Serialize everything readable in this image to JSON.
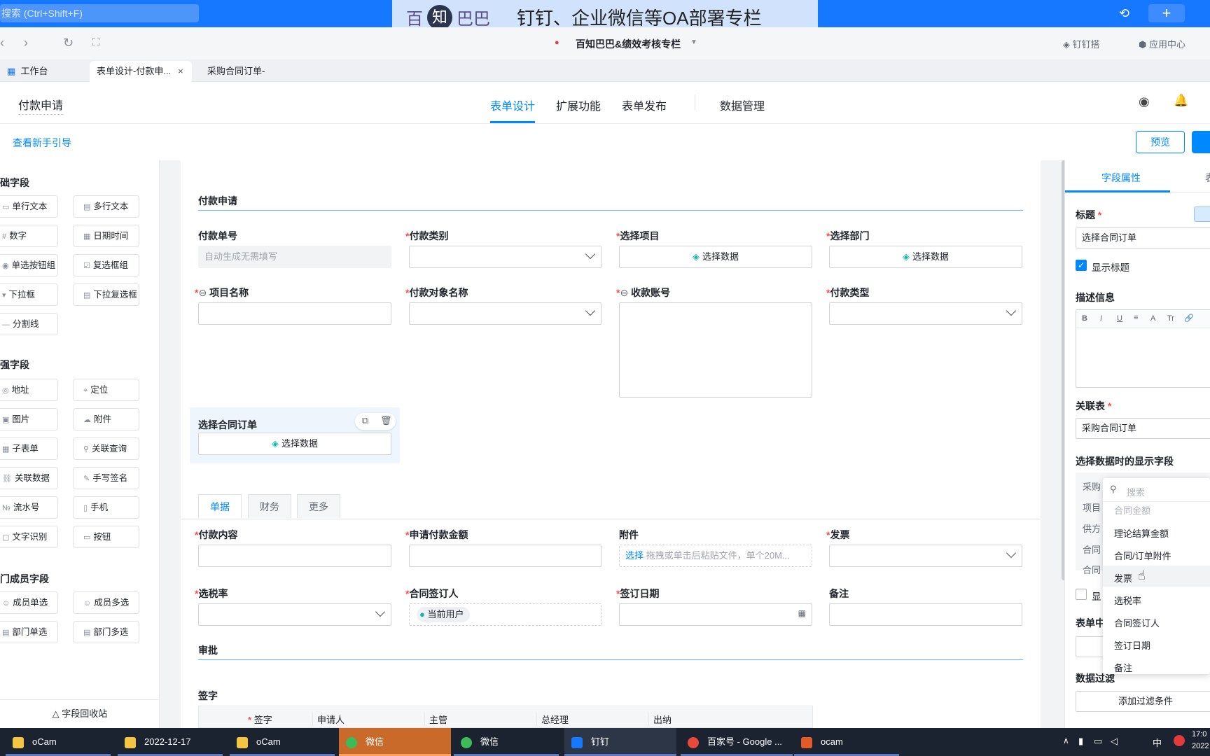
{
  "topbar": {
    "search_placeholder": "搜索 (Ctrl+Shift+F)",
    "plus": "+"
  },
  "banner": {
    "part1": "百",
    "part2": "知",
    "part3": "巴巴",
    "text": "钉钉、企业微信等OA部署专栏"
  },
  "browser": {
    "app_title": "百知巴巴&绩效考核专栏",
    "right_links": [
      "钉钉搭",
      "应用中心"
    ]
  },
  "tabs": [
    {
      "label": "工作台"
    },
    {
      "label": "表单设计-付款申...",
      "close": "×"
    },
    {
      "label": "采购合同订单-项...",
      "close": "×"
    }
  ],
  "header": {
    "form_name": "付款申请",
    "nav": [
      "表单设计",
      "扩展功能",
      "表单发布",
      "数据管理"
    ]
  },
  "subbar": {
    "guide": "查看新手引导",
    "preview": "预览"
  },
  "left": {
    "sections": [
      "础字段",
      "强字段",
      "门成员字段"
    ],
    "basic": [
      "单行文本",
      "多行文本",
      "数字",
      "日期时间",
      "单选按钮组",
      "复选框组",
      "下拉框",
      "下拉复选框",
      "分割线"
    ],
    "enhanced": [
      "地址",
      "定位",
      "图片",
      "附件",
      "子表单",
      "关联查询",
      "关联数据",
      "手写签名",
      "流水号",
      "手机",
      "文字识别",
      "按钮"
    ],
    "member": [
      "成员单选",
      "成员多选",
      "部门单选",
      "部门多选"
    ],
    "recycle": "字段回收站"
  },
  "form": {
    "section1": "付款申请",
    "row1": [
      {
        "label": "付款单号",
        "req": false,
        "placeholder": "自动生成无需填写"
      },
      {
        "label": "付款类别",
        "req": true
      },
      {
        "label": "选择项目",
        "req": true,
        "btn": "选择数据"
      },
      {
        "label": "选择部门",
        "req": true,
        "btn": "选择数据"
      }
    ],
    "row2": [
      {
        "label": "项目名称",
        "req": true
      },
      {
        "label": "付款对象名称",
        "req": true
      },
      {
        "label": "收款账号",
        "req": true
      },
      {
        "label": "付款类型",
        "req": true
      }
    ],
    "selected_field": {
      "label": "选择合同订单",
      "btn": "选择数据"
    },
    "inner_tabs": [
      "单据",
      "财务",
      "更多"
    ],
    "row3": [
      {
        "label": "付款内容",
        "req": true
      },
      {
        "label": "申请付款金额",
        "req": true
      },
      {
        "label": "附件",
        "req": false,
        "link": "选择",
        "hint": "拖拽或单击后粘贴文件，单个20M..."
      },
      {
        "label": "发票",
        "req": true
      }
    ],
    "row4": [
      {
        "label": "选税率",
        "req": true
      },
      {
        "label": "合同签订人",
        "req": true,
        "user": "当前用户"
      },
      {
        "label": "签订日期",
        "req": true
      },
      {
        "label": "备注",
        "req": false
      }
    ],
    "section2": "审批",
    "sign_label": "签字",
    "sign_cols": [
      "签字",
      "申请人",
      "主管",
      "总经理",
      "出纳"
    ]
  },
  "right": {
    "tabs": [
      "字段属性",
      "表"
    ],
    "title_label": "标题",
    "title_value": "选择合同订单",
    "show_title": "显示标题",
    "desc_label": "描述信息",
    "toolbar": [
      "B",
      "I",
      "U",
      "≡",
      "A",
      "Tr",
      "🔗"
    ],
    "rel_label": "关联表",
    "rel_value": "采购合同订单",
    "display_label": "选择数据时的显示字段",
    "partial_rows": [
      "采购",
      "项目",
      "供方",
      "合同",
      "合同"
    ],
    "checkbox_partial": "显",
    "form_label_partial": "表单中",
    "filter_label": "数据过滤",
    "filter_btn": "添加过滤条件"
  },
  "dropdown": {
    "search_placeholder": "搜索",
    "items": [
      "合同金额",
      "理论结算金额",
      "合同/订单附件",
      "发票",
      "选税率",
      "合同签订人",
      "签订日期",
      "备注"
    ]
  },
  "taskbar": {
    "items": [
      "oCam",
      "2022-12-17",
      "oCam",
      "微信",
      "微信",
      "钉钉",
      "百家号 - Google ...",
      "ocam"
    ],
    "time": "17:0",
    "date": "2022",
    "ime": "中"
  }
}
